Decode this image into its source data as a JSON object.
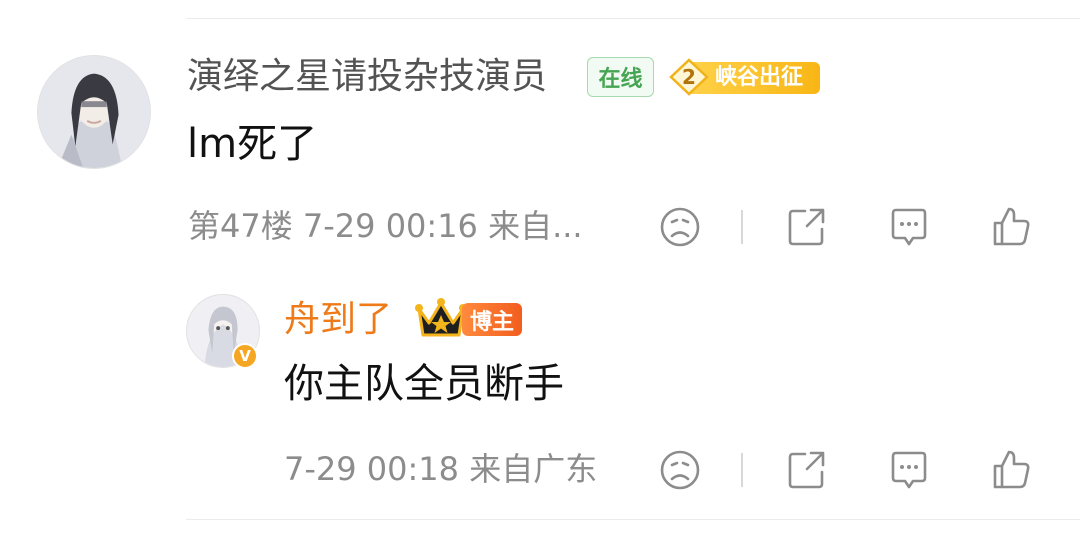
{
  "comment": {
    "username": "演绎之星请投杂技演员",
    "online_label": "在线",
    "rank_level": "2",
    "rank_label": "峡谷出征",
    "content": "lm死了",
    "meta": "第47楼 7-29 00:16 来自...",
    "actions": [
      "dislike",
      "share",
      "comment",
      "like"
    ]
  },
  "reply": {
    "username": "舟到了",
    "badge_label": "博主",
    "verified_mark": "V",
    "content": "你主队全员断手",
    "meta": "7-29 00:18 来自广东",
    "actions": [
      "dislike",
      "share",
      "comment",
      "like"
    ]
  },
  "colors": {
    "reply_name": "#ee7a19",
    "online_green": "#45a552",
    "rank_gold": "#f8b614",
    "icon_gray": "#8c8c8c"
  }
}
